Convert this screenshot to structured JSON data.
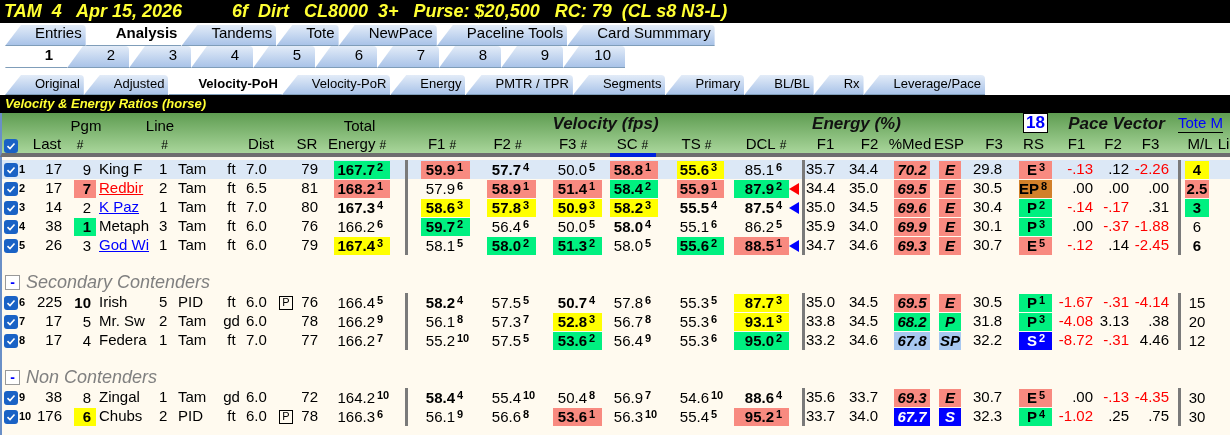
{
  "title_bar": {
    "race": "TAM  4   Apr 15, 2026",
    "conditions": "6f  Dirt   CL8000  3+   Purse: $20,500   RC: 79  (CL s8 N3-L)"
  },
  "main_tabs": [
    {
      "label": "Entries",
      "selected": false
    },
    {
      "label": "Analysis",
      "selected": true
    },
    {
      "label": "Tandems",
      "selected": false
    },
    {
      "label": "Tote",
      "selected": false
    },
    {
      "label": "NewPace",
      "selected": false
    },
    {
      "label": "Paceline Tools",
      "selected": false
    },
    {
      "label": "Card Summmary",
      "selected": false
    }
  ],
  "race_tabs": [
    {
      "label": "1",
      "selected": true
    },
    {
      "label": "2",
      "selected": false
    },
    {
      "label": "3",
      "selected": false
    },
    {
      "label": "4",
      "selected": false
    },
    {
      "label": "5",
      "selected": false
    },
    {
      "label": "6",
      "selected": false
    },
    {
      "label": "7",
      "selected": false
    },
    {
      "label": "8",
      "selected": false
    },
    {
      "label": "9",
      "selected": false
    },
    {
      "label": "10",
      "selected": false
    }
  ],
  "view_tabs": [
    {
      "label": "Original",
      "selected": false
    },
    {
      "label": "Adjusted",
      "selected": false
    },
    {
      "label": "Velocity-PoH",
      "selected": true
    },
    {
      "label": "Velocity-PoR",
      "selected": false
    },
    {
      "label": "Energy",
      "selected": false
    },
    {
      "label": "PMTR / TPR",
      "selected": false
    },
    {
      "label": "Segments",
      "selected": false
    },
    {
      "label": "Primary",
      "selected": false
    },
    {
      "label": "BL/BL",
      "selected": false
    },
    {
      "label": "Rx",
      "selected": false
    },
    {
      "label": "Leverage/Pace",
      "selected": false
    }
  ],
  "section_title": "Velocity & Energy Ratios (horse)",
  "header": {
    "checked": true,
    "race_count": "18",
    "tote": "Tote M",
    "groups": [
      "Velocity (fps)",
      "Energy (%)",
      "Pace Vector"
    ],
    "columns": [
      {
        "label": "Last"
      },
      {
        "top": "Pgm",
        "unit": "#"
      },
      {
        "top": "Line",
        "unit": "#"
      },
      {
        "label": "Dist"
      },
      {
        "label": "SR"
      },
      {
        "top": "Total",
        "label": "Energy",
        "unit": "#"
      },
      {
        "label": "F1",
        "unit": "#"
      },
      {
        "label": "F2",
        "unit": "#"
      },
      {
        "label": "F3",
        "unit": "#"
      },
      {
        "label": "SC",
        "unit": "#",
        "sorted": true
      },
      {
        "label": "TS",
        "unit": "#"
      },
      {
        "label": "DCL",
        "unit": "#"
      },
      {
        "label": "F1"
      },
      {
        "label": "F2"
      },
      {
        "label": "%Med"
      },
      {
        "label": "ESP"
      },
      {
        "label": "F3"
      },
      {
        "label": "RS"
      },
      {
        "label": "F1"
      },
      {
        "label": "F2"
      },
      {
        "label": "F3"
      },
      {
        "label": "M/L"
      },
      {
        "label": "Li"
      }
    ]
  },
  "groups": [
    {
      "rows": [
        {
          "selected": true,
          "checked": true,
          "num": "1",
          "last": "17",
          "pgm": {
            "v": "9",
            "bold": false
          },
          "name": {
            "v": "King F",
            "link": false
          },
          "line": "1",
          "track": "Tam",
          "surface": "ft",
          "dist": "7.0",
          "sr": "79",
          "total": {
            "v": "167.7",
            "rank": "2",
            "bold": true,
            "color": "#00f080"
          },
          "f1": {
            "v": "59.9",
            "rank": "1",
            "bold": true,
            "color": "#f88a80"
          },
          "f2": {
            "v": "57.7",
            "rank": "4",
            "bold": true
          },
          "f3": {
            "v": "50.0",
            "rank": "5",
            "bold": false
          },
          "sc": {
            "v": "58.8",
            "rank": "1",
            "bold": true,
            "color": "#f88a80"
          },
          "ts": {
            "v": "55.6",
            "rank": "3",
            "bold": true,
            "color": "#ffff00"
          },
          "dcl": {
            "v": "85.1",
            "rank": "6",
            "bold": false
          },
          "e_f1": "35.7",
          "e_f2": "34.4",
          "med": {
            "v": "70.2",
            "color": "#f88a80"
          },
          "esp": {
            "v": "E",
            "color": "#f88a80"
          },
          "e_f3": "29.8",
          "rs": {
            "v": "E",
            "rank": "3",
            "color": "#f88a80"
          },
          "pv": [
            {
              "v": "-.13",
              "negative": true
            },
            {
              "v": ".12",
              "negative": false
            },
            {
              "v": "-2.26",
              "negative": true
            }
          ],
          "ml": {
            "v": "4",
            "bold": true,
            "color": "#ffff00"
          }
        },
        {
          "selected": false,
          "checked": true,
          "num": "2",
          "last": "17",
          "pgm": {
            "v": "7",
            "bold": true,
            "color": "#f88a80"
          },
          "name": {
            "v": "Redbir",
            "link": true,
            "color": "#ff0000"
          },
          "line": "2",
          "track": "Tam",
          "surface": "ft",
          "dist": "6.5",
          "sr": "81",
          "total": {
            "v": "168.2",
            "rank": "1",
            "bold": true,
            "color": "#f88a80"
          },
          "f1": {
            "v": "57.9",
            "rank": "6",
            "bold": false
          },
          "f2": {
            "v": "58.9",
            "rank": "1",
            "bold": true,
            "color": "#f88a80"
          },
          "f3": {
            "v": "51.4",
            "rank": "1",
            "bold": true,
            "color": "#f88a80"
          },
          "sc": {
            "v": "58.4",
            "rank": "2",
            "bold": true,
            "color": "#00f080"
          },
          "ts": {
            "v": "55.9",
            "rank": "1",
            "bold": true,
            "color": "#f88a80"
          },
          "dcl": {
            "v": "87.9",
            "rank": "2",
            "bold": true,
            "color": "#00f080",
            "pointer": {
              "color": "#ff0000"
            }
          },
          "e_f1": "34.4",
          "e_f2": "35.0",
          "med": {
            "v": "69.5",
            "color": "#f88a80"
          },
          "esp": {
            "v": "E",
            "color": "#f88a80"
          },
          "e_f3": "30.5",
          "rs": {
            "v": "EP",
            "rank": "8",
            "color": "#d2802a"
          },
          "pv": [
            {
              "v": ".00",
              "negative": false
            },
            {
              "v": ".00",
              "negative": false
            },
            {
              "v": ".00",
              "negative": false
            }
          ],
          "ml": {
            "v": "2.5",
            "bold": true,
            "color": "#f88a80"
          }
        },
        {
          "selected": false,
          "checked": true,
          "num": "3",
          "last": "14",
          "pgm": {
            "v": "2",
            "bold": false
          },
          "name": {
            "v": "K Paz",
            "link": true,
            "color": "#0000ff"
          },
          "line": "1",
          "track": "Tam",
          "surface": "ft",
          "dist": "7.0",
          "sr": "80",
          "total": {
            "v": "167.3",
            "rank": "4",
            "bold": true
          },
          "f1": {
            "v": "58.6",
            "rank": "3",
            "bold": true,
            "color": "#ffff00"
          },
          "f2": {
            "v": "57.8",
            "rank": "3",
            "bold": true,
            "color": "#ffff00"
          },
          "f3": {
            "v": "50.9",
            "rank": "3",
            "bold": true,
            "color": "#ffff00"
          },
          "sc": {
            "v": "58.2",
            "rank": "3",
            "bold": true,
            "color": "#ffff00"
          },
          "ts": {
            "v": "55.5",
            "rank": "4",
            "bold": true
          },
          "dcl": {
            "v": "87.5",
            "rank": "4",
            "bold": true,
            "pointer": {
              "color": "#0000ff"
            }
          },
          "e_f1": "35.0",
          "e_f2": "34.5",
          "med": {
            "v": "69.6",
            "color": "#f88a80"
          },
          "esp": {
            "v": "E",
            "color": "#f88a80"
          },
          "e_f3": "30.4",
          "rs": {
            "v": "P",
            "rank": "2",
            "color": "#00f080"
          },
          "pv": [
            {
              "v": "-.14",
              "negative": true
            },
            {
              "v": "-.17",
              "negative": true
            },
            {
              "v": ".31",
              "negative": false
            }
          ],
          "ml": {
            "v": "3",
            "bold": true,
            "color": "#00f080"
          }
        },
        {
          "selected": false,
          "checked": true,
          "num": "4",
          "last": "38",
          "pgm": {
            "v": "1",
            "bold": true,
            "color": "#00f080"
          },
          "name": {
            "v": "Metaph",
            "link": false
          },
          "line": "3",
          "track": "Tam",
          "surface": "ft",
          "dist": "6.0",
          "sr": "76",
          "total": {
            "v": "166.2",
            "rank": "6",
            "bold": false
          },
          "f1": {
            "v": "59.7",
            "rank": "2",
            "bold": true,
            "color": "#00f080"
          },
          "f2": {
            "v": "56.4",
            "rank": "6",
            "bold": false
          },
          "f3": {
            "v": "50.0",
            "rank": "5",
            "bold": false
          },
          "sc": {
            "v": "58.0",
            "rank": "4",
            "bold": true
          },
          "ts": {
            "v": "55.1",
            "rank": "6",
            "bold": false
          },
          "dcl": {
            "v": "86.2",
            "rank": "5",
            "bold": false
          },
          "e_f1": "35.9",
          "e_f2": "34.0",
          "med": {
            "v": "69.9",
            "color": "#f88a80"
          },
          "esp": {
            "v": "E",
            "color": "#f88a80"
          },
          "e_f3": "30.1",
          "rs": {
            "v": "P",
            "rank": "3",
            "color": "#00f080"
          },
          "pv": [
            {
              "v": ".00",
              "negative": false
            },
            {
              "v": "-.37",
              "negative": true
            },
            {
              "v": "-1.88",
              "negative": true
            }
          ],
          "ml": {
            "v": "6",
            "bold": false
          }
        },
        {
          "selected": false,
          "checked": true,
          "num": "5",
          "last": "26",
          "pgm": {
            "v": "3",
            "bold": false
          },
          "name": {
            "v": "God Wi",
            "link": true,
            "color": "#0000ff"
          },
          "line": "1",
          "track": "Tam",
          "surface": "ft",
          "dist": "6.0",
          "sr": "79",
          "total": {
            "v": "167.4",
            "rank": "3",
            "bold": true,
            "color": "#ffff00"
          },
          "f1": {
            "v": "58.1",
            "rank": "5",
            "bold": false
          },
          "f2": {
            "v": "58.0",
            "rank": "2",
            "bold": true,
            "color": "#00f080"
          },
          "f3": {
            "v": "51.3",
            "rank": "2",
            "bold": true,
            "color": "#00f080"
          },
          "sc": {
            "v": "58.0",
            "rank": "5",
            "bold": false
          },
          "ts": {
            "v": "55.6",
            "rank": "2",
            "bold": true,
            "color": "#00f080"
          },
          "dcl": {
            "v": "88.5",
            "rank": "1",
            "bold": true,
            "color": "#f88a80",
            "pointer": {
              "color": "#0000ff"
            }
          },
          "e_f1": "34.7",
          "e_f2": "34.6",
          "med": {
            "v": "69.3",
            "color": "#f88a80"
          },
          "esp": {
            "v": "E",
            "color": "#f88a80"
          },
          "e_f3": "30.7",
          "rs": {
            "v": "E",
            "rank": "5",
            "color": "#f88a80"
          },
          "pv": [
            {
              "v": "-.12",
              "negative": true
            },
            {
              "v": ".14",
              "negative": false
            },
            {
              "v": "-2.45",
              "negative": true
            }
          ],
          "ml": {
            "v": "6",
            "bold": true
          }
        }
      ]
    },
    {
      "title": "Secondary Contenders",
      "toggle": "-",
      "rows": [
        {
          "selected": false,
          "checked": true,
          "num": "6",
          "last": "225",
          "pgm": {
            "v": "10",
            "bold": true
          },
          "name": {
            "v": "Irish",
            "link": false
          },
          "line": "5",
          "track": "PID",
          "surface": "ft",
          "dist": "6.0",
          "flag": "P",
          "sr": "76",
          "total": {
            "v": "166.4",
            "rank": "5",
            "bold": false
          },
          "f1": {
            "v": "58.2",
            "rank": "4",
            "bold": true
          },
          "f2": {
            "v": "57.5",
            "rank": "5",
            "bold": false
          },
          "f3": {
            "v": "50.7",
            "rank": "4",
            "bold": true
          },
          "sc": {
            "v": "57.8",
            "rank": "6",
            "bold": false
          },
          "ts": {
            "v": "55.3",
            "rank": "5",
            "bold": false
          },
          "dcl": {
            "v": "87.7",
            "rank": "3",
            "bold": true,
            "color": "#ffff00"
          },
          "e_f1": "35.0",
          "e_f2": "34.5",
          "med": {
            "v": "69.5",
            "color": "#f88a80"
          },
          "esp": {
            "v": "E",
            "color": "#f88a80"
          },
          "e_f3": "30.5",
          "rs": {
            "v": "P",
            "rank": "1",
            "color": "#00f080"
          },
          "pv": [
            {
              "v": "-1.67",
              "negative": true
            },
            {
              "v": "-.31",
              "negative": true
            },
            {
              "v": "-4.14",
              "negative": true
            }
          ],
          "ml": {
            "v": "15",
            "bold": false
          }
        },
        {
          "selected": false,
          "checked": true,
          "num": "7",
          "last": "17",
          "pgm": {
            "v": "5",
            "bold": false
          },
          "name": {
            "v": "Mr. Sw",
            "link": false
          },
          "line": "2",
          "track": "Tam",
          "surface": "gd",
          "dist": "6.0",
          "sr": "78",
          "total": {
            "v": "166.2",
            "rank": "9",
            "bold": false
          },
          "f1": {
            "v": "56.1",
            "rank": "8",
            "bold": false
          },
          "f2": {
            "v": "57.3",
            "rank": "7",
            "bold": false
          },
          "f3": {
            "v": "52.8",
            "rank": "3",
            "bold": true,
            "color": "#ffff00"
          },
          "sc": {
            "v": "56.7",
            "rank": "8",
            "bold": false
          },
          "ts": {
            "v": "55.3",
            "rank": "6",
            "bold": false
          },
          "dcl": {
            "v": "93.1",
            "rank": "3",
            "bold": true,
            "color": "#ffff00"
          },
          "e_f1": "33.8",
          "e_f2": "34.5",
          "med": {
            "v": "68.2",
            "color": "#00f080"
          },
          "esp": {
            "v": "P",
            "color": "#00f080"
          },
          "e_f3": "31.8",
          "rs": {
            "v": "P",
            "rank": "3",
            "color": "#00f080"
          },
          "pv": [
            {
              "v": "-4.08",
              "negative": true
            },
            {
              "v": "3.13",
              "negative": false
            },
            {
              "v": ".38",
              "negative": false
            }
          ],
          "ml": {
            "v": "20",
            "bold": false
          }
        },
        {
          "selected": false,
          "checked": true,
          "num": "8",
          "last": "17",
          "pgm": {
            "v": "4",
            "bold": false
          },
          "name": {
            "v": "Federa",
            "link": false
          },
          "line": "1",
          "track": "Tam",
          "surface": "ft",
          "dist": "7.0",
          "sr": "77",
          "total": {
            "v": "166.2",
            "rank": "7",
            "bold": false
          },
          "f1": {
            "v": "55.2",
            "rank": "10",
            "bold": false
          },
          "f2": {
            "v": "57.5",
            "rank": "5",
            "bold": false
          },
          "f3": {
            "v": "53.6",
            "rank": "2",
            "bold": true,
            "color": "#00f080"
          },
          "sc": {
            "v": "56.4",
            "rank": "9",
            "bold": false
          },
          "ts": {
            "v": "55.3",
            "rank": "6",
            "bold": false
          },
          "dcl": {
            "v": "95.0",
            "rank": "2",
            "bold": true,
            "color": "#00f080"
          },
          "e_f1": "33.2",
          "e_f2": "34.6",
          "med": {
            "v": "67.8",
            "color": "#a8c8f0"
          },
          "esp": {
            "v": "SP",
            "color": "#a8c8f0"
          },
          "e_f3": "32.2",
          "rs": {
            "v": "S",
            "rank": "2",
            "color": "#0000ff"
          },
          "pv": [
            {
              "v": "-8.72",
              "negative": true
            },
            {
              "v": "-.31",
              "negative": true
            },
            {
              "v": "4.46",
              "negative": false
            }
          ],
          "ml": {
            "v": "12",
            "bold": false
          }
        }
      ]
    },
    {
      "title": "Non Contenders",
      "toggle": "-",
      "rows": [
        {
          "selected": false,
          "checked": true,
          "num": "9",
          "last": "38",
          "pgm": {
            "v": "8",
            "bold": false
          },
          "name": {
            "v": "Zingal",
            "link": false
          },
          "line": "1",
          "track": "Tam",
          "surface": "gd",
          "dist": "6.0",
          "sr": "72",
          "total": {
            "v": "164.2",
            "rank": "10",
            "bold": false
          },
          "f1": {
            "v": "58.4",
            "rank": "4",
            "bold": true
          },
          "f2": {
            "v": "55.4",
            "rank": "10",
            "bold": false
          },
          "f3": {
            "v": "50.4",
            "rank": "8",
            "bold": false
          },
          "sc": {
            "v": "56.9",
            "rank": "7",
            "bold": false
          },
          "ts": {
            "v": "54.6",
            "rank": "10",
            "bold": false
          },
          "dcl": {
            "v": "88.6",
            "rank": "4",
            "bold": true
          },
          "e_f1": "35.6",
          "e_f2": "33.7",
          "med": {
            "v": "69.3",
            "color": "#f88a80"
          },
          "esp": {
            "v": "E",
            "color": "#f88a80"
          },
          "e_f3": "30.7",
          "rs": {
            "v": "E",
            "rank": "5",
            "color": "#f88a80"
          },
          "pv": [
            {
              "v": ".00",
              "negative": false
            },
            {
              "v": "-.13",
              "negative": true
            },
            {
              "v": "-4.35",
              "negative": true
            }
          ],
          "ml": {
            "v": "30",
            "bold": false
          }
        },
        {
          "selected": false,
          "checked": true,
          "num": "10",
          "last": "176",
          "pgm": {
            "v": "6",
            "bold": true,
            "color": "#ffff00"
          },
          "name": {
            "v": "Chubs",
            "link": false
          },
          "line": "2",
          "track": "PID",
          "surface": "ft",
          "dist": "6.0",
          "flag": "P",
          "sr": "78",
          "total": {
            "v": "166.3",
            "rank": "6",
            "bold": false
          },
          "f1": {
            "v": "56.1",
            "rank": "9",
            "bold": false
          },
          "f2": {
            "v": "56.6",
            "rank": "8",
            "bold": false
          },
          "f3": {
            "v": "53.6",
            "rank": "1",
            "bold": true,
            "color": "#f88a80"
          },
          "sc": {
            "v": "56.3",
            "rank": "10",
            "bold": false
          },
          "ts": {
            "v": "55.4",
            "rank": "5",
            "bold": false
          },
          "dcl": {
            "v": "95.2",
            "rank": "1",
            "bold": true,
            "color": "#f88a80"
          },
          "e_f1": "33.7",
          "e_f2": "34.0",
          "med": {
            "v": "67.7",
            "color": "#0000ff"
          },
          "esp": {
            "v": "S",
            "color": "#0000ff"
          },
          "e_f3": "32.3",
          "rs": {
            "v": "P",
            "rank": "4",
            "color": "#00f080"
          },
          "pv": [
            {
              "v": "-1.02",
              "negative": true
            },
            {
              "v": ".25",
              "negative": false
            },
            {
              "v": ".75",
              "negative": false
            }
          ],
          "ml": {
            "v": "30",
            "bold": false
          }
        }
      ]
    }
  ]
}
